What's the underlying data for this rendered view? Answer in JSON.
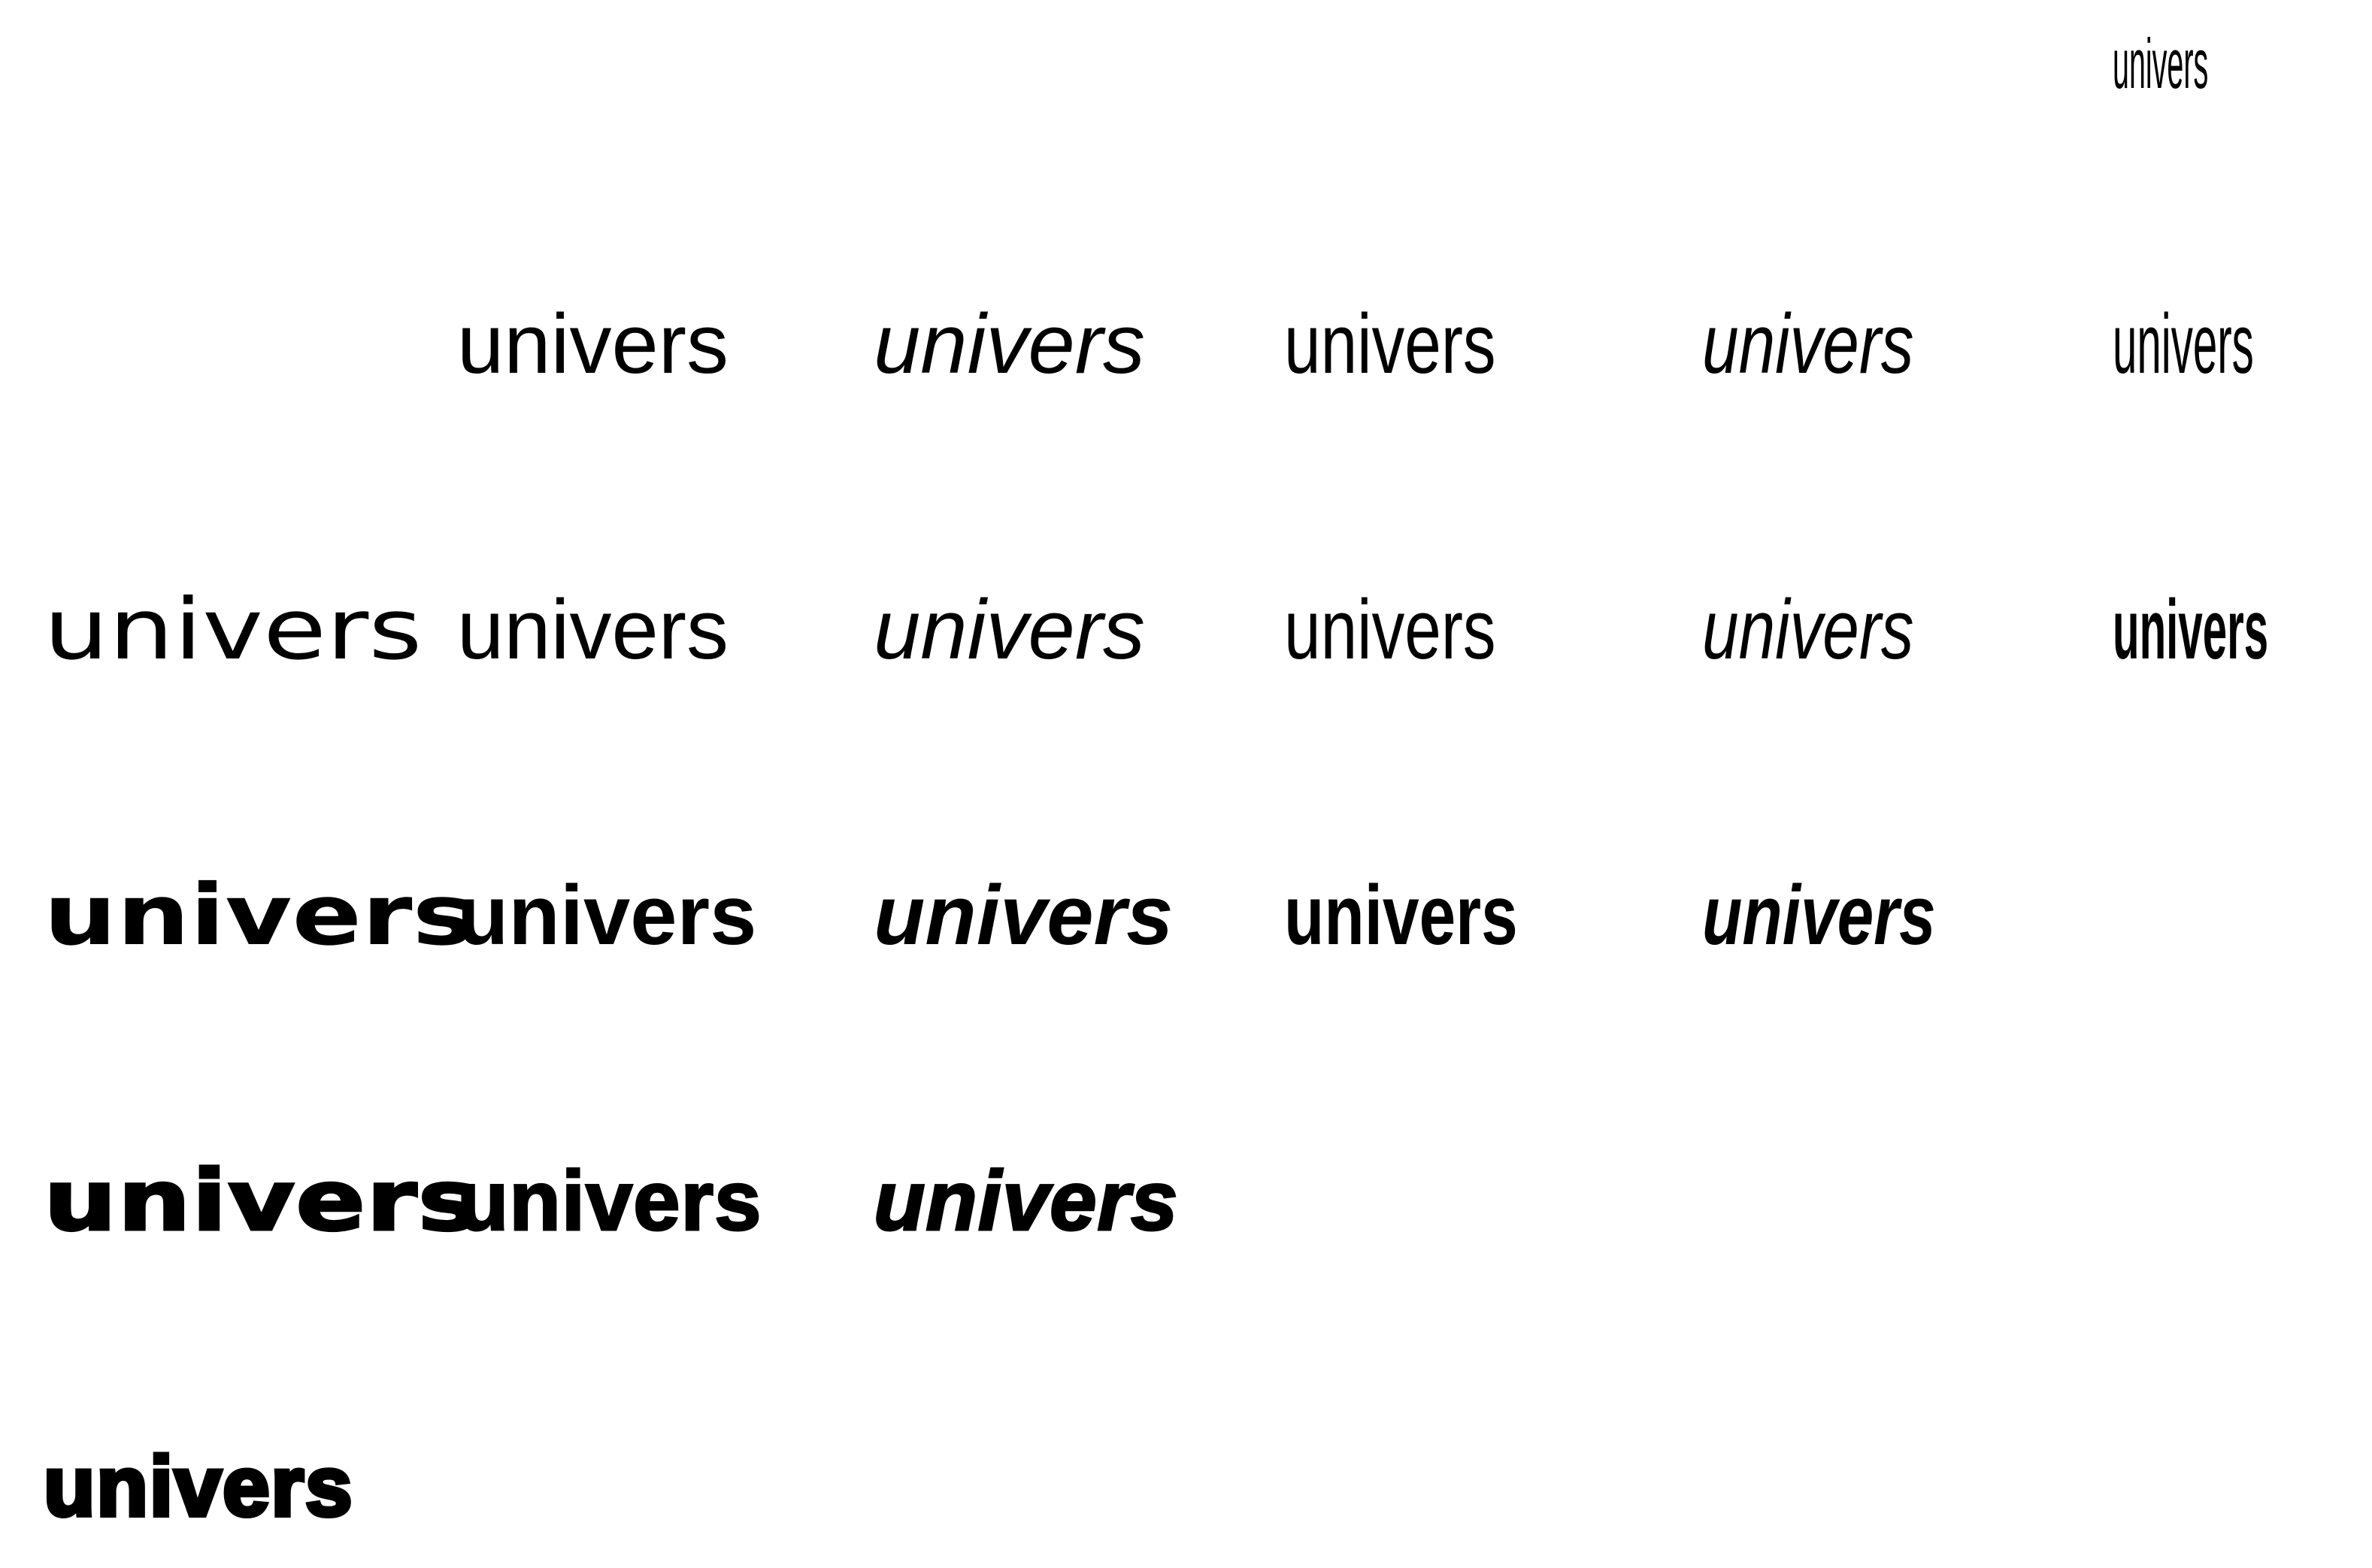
{
  "specimen": {
    "word": "univers",
    "text_color": "#000000",
    "background_color": "#ffffff",
    "rows": [
      {
        "cells": [
          {
            "label": "univers",
            "col": 6,
            "variant": "ultra-condensed-thin"
          }
        ]
      },
      {
        "cells": [
          {
            "label": "univers",
            "col": 2,
            "variant": "light"
          },
          {
            "label": "univers",
            "col": 3,
            "variant": "light-italic"
          },
          {
            "label": "univers",
            "col": 4,
            "variant": "light-condensed"
          },
          {
            "label": "univers",
            "col": 5,
            "variant": "light-condensed-italic"
          },
          {
            "label": "univers",
            "col": 6,
            "variant": "thin-ultra-condensed"
          }
        ]
      },
      {
        "cells": [
          {
            "label": "univers",
            "col": 1,
            "variant": "extended"
          },
          {
            "label": "univers",
            "col": 2,
            "variant": "roman"
          },
          {
            "label": "univers",
            "col": 3,
            "variant": "oblique"
          },
          {
            "label": "univers",
            "col": 4,
            "variant": "condensed"
          },
          {
            "label": "univers",
            "col": 5,
            "variant": "condensed-oblique"
          },
          {
            "label": "univers",
            "col": 6,
            "variant": "ultra-condensed"
          }
        ]
      },
      {
        "cells": [
          {
            "label": "univers",
            "col": 1,
            "variant": "bold-extended"
          },
          {
            "label": "univers",
            "col": 2,
            "variant": "bold"
          },
          {
            "label": "univers",
            "col": 3,
            "variant": "bold-oblique"
          },
          {
            "label": "univers",
            "col": 4,
            "variant": "bold-condensed"
          },
          {
            "label": "univers",
            "col": 5,
            "variant": "bold-condensed-oblique"
          }
        ]
      },
      {
        "cells": [
          {
            "label": "univers",
            "col": 1,
            "variant": "black-extended"
          },
          {
            "label": "univers",
            "col": 2,
            "variant": "black"
          },
          {
            "label": "univers",
            "col": 3,
            "variant": "black-oblique"
          }
        ]
      },
      {
        "cells": [
          {
            "label": "univers",
            "col": 1,
            "variant": "extra-black"
          }
        ]
      }
    ]
  }
}
